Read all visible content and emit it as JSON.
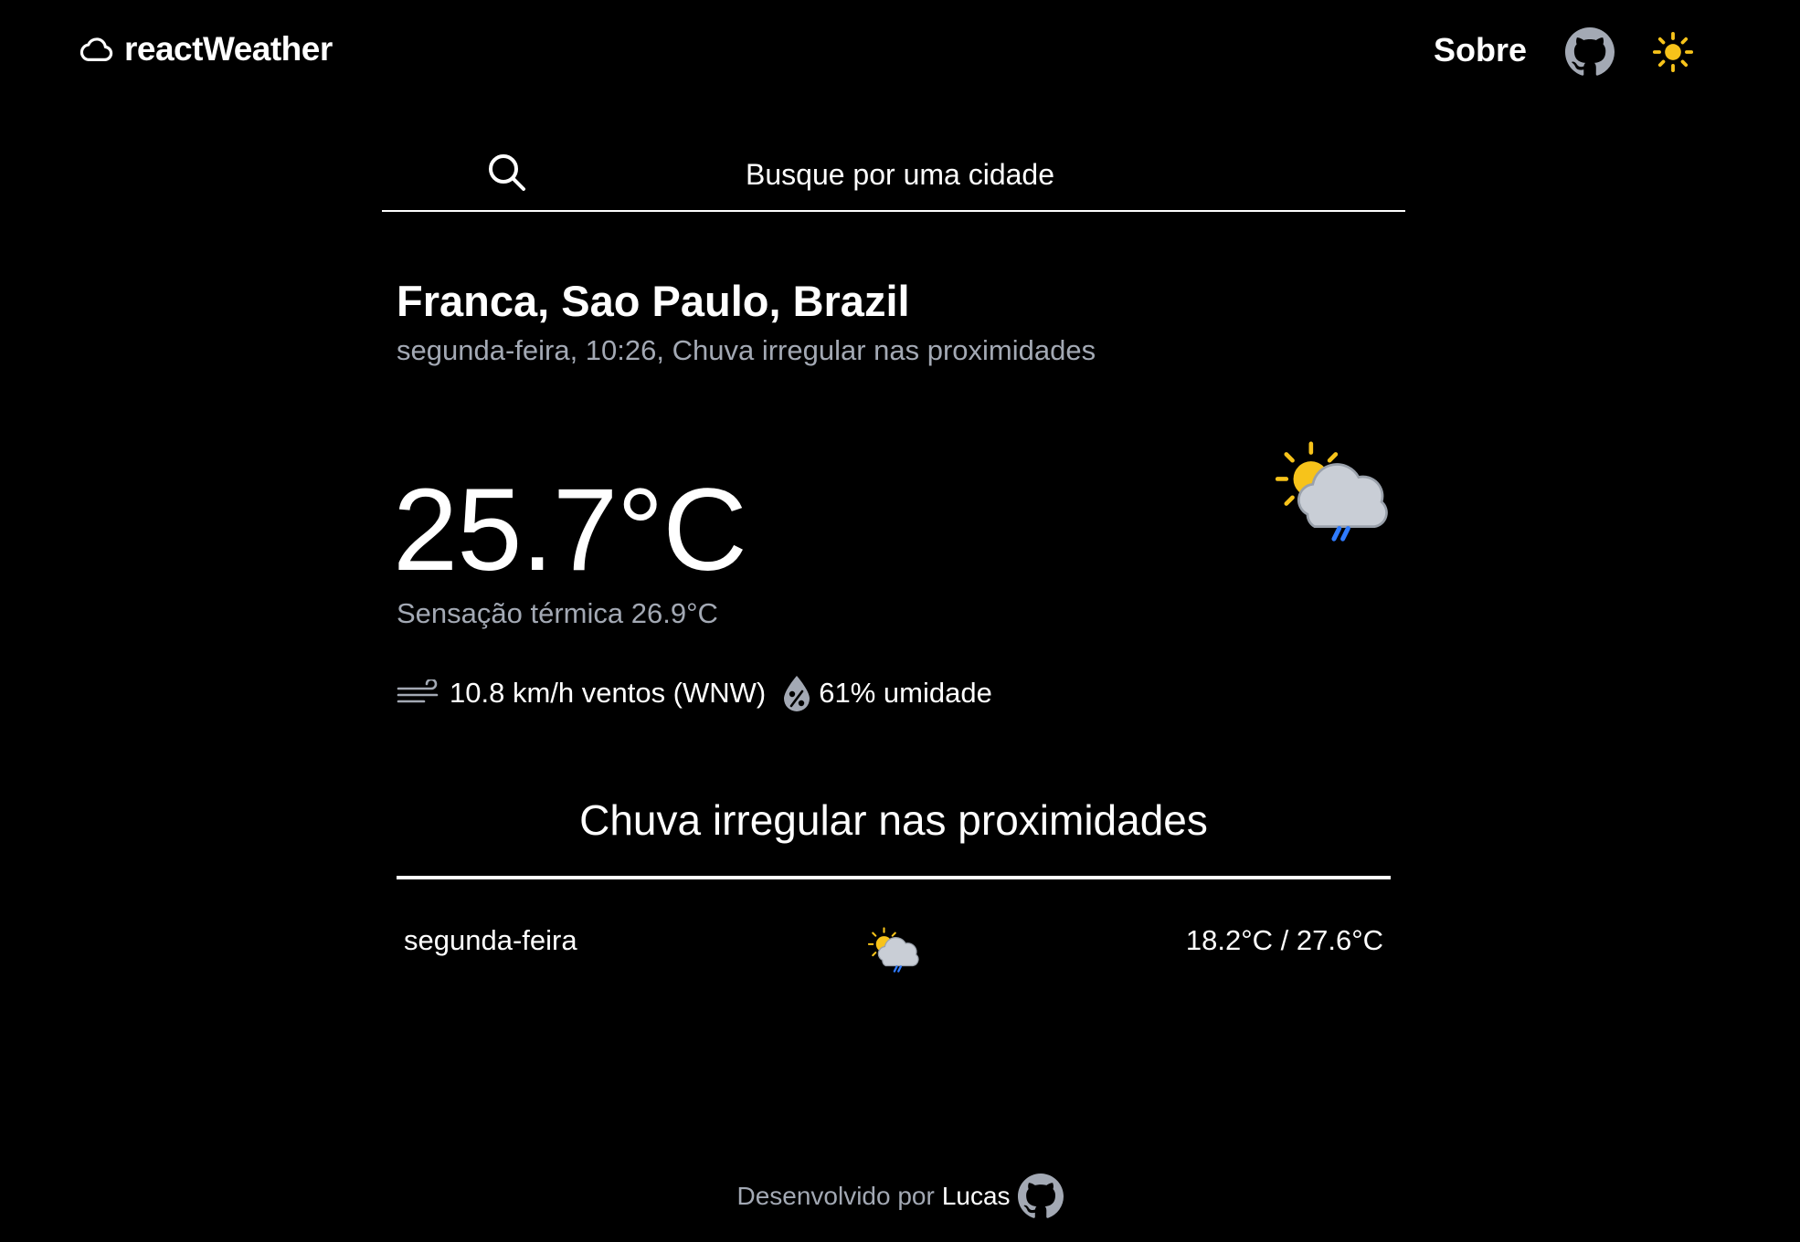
{
  "header": {
    "brand": "reactWeather",
    "brand_icon": "cloud-icon",
    "nav": {
      "about_label": "Sobre",
      "github_icon": "github-icon",
      "theme_icon": "sun-icon"
    }
  },
  "search": {
    "placeholder": "Busque por uma cidade",
    "value": "",
    "icon": "search-icon"
  },
  "current": {
    "location": "Franca, Sao Paulo, Brazil",
    "subtitle": "segunda-feira, 10:26, Chuva irregular nas proximidades",
    "temperature": "25.7°C",
    "feels_like": "Sensação térmica 26.9°C",
    "wind": "10.8 km/h ventos (WNW)",
    "humidity": "61% umidade",
    "condition": "Chuva irregular nas proximidades",
    "icon": "sun-cloud-rain-icon"
  },
  "forecast": [
    {
      "day": "segunda-feira",
      "icon": "sun-cloud-rain-icon",
      "temps": "18.2°C / 27.6°C"
    }
  ],
  "footer": {
    "text": "Desenvolvido por",
    "author": "Lucas",
    "icon": "github-icon"
  },
  "colors": {
    "background": "#000000",
    "text": "#ffffff",
    "muted_text": "#a3a9b4",
    "sun": "#f7c31a",
    "rain": "#2f7bff"
  }
}
